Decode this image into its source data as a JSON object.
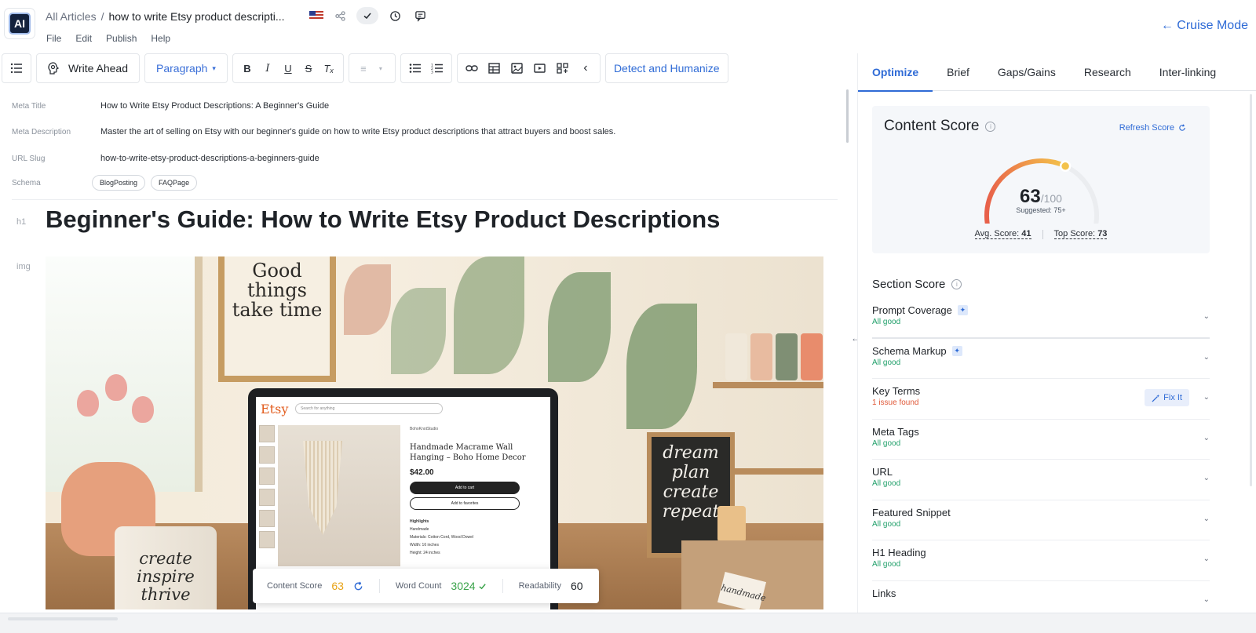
{
  "header": {
    "breadcrumb_root": "All Articles",
    "breadcrumb_sep": "/",
    "article_title": "how to write Etsy product descripti...",
    "logo_text": "AI",
    "menu": [
      "File",
      "Edit",
      "Publish",
      "Help"
    ],
    "cruise_mode": "← Cruise Mode"
  },
  "toolbar": {
    "write_ahead": "Write Ahead",
    "paragraph": "Paragraph",
    "detect_humanize": "Detect and Humanize"
  },
  "meta": {
    "title_label": "Meta Title",
    "title_value": "How to Write Etsy Product Descriptions: A Beginner's Guide",
    "desc_label": "Meta Description",
    "desc_value": "Master the art of selling on Etsy with our beginner's guide on how to write Etsy product descriptions that attract buyers and boost sales.",
    "slug_label": "URL Slug",
    "slug_value": "how-to-write-etsy-product-descriptions-a-beginners-guide",
    "schema_label": "Schema",
    "schema_chips": [
      "BlogPosting",
      "FAQPage"
    ]
  },
  "content": {
    "h1_tag": "h1",
    "h1_text": "Beginner's Guide: How to Write Etsy Product Descriptions",
    "img_tag": "img"
  },
  "hero_image": {
    "frame_text": "Good things take time",
    "etsy_logo": "Etsy",
    "search_placeholder": "Search for anything",
    "shop_name": "BohoKnotStudio",
    "product_title": "Handmade Macrame Wall Hanging – Boho Home Decor",
    "price": "$42.00",
    "add_to_cart": "Add to cart",
    "add_to_favorites": "Add to favorites",
    "highlights_title": "Highlights",
    "highlights": [
      "Handmade",
      "Materials: Cotton Cord, Wood Dowel",
      "Width: 16 inches",
      "Height: 24 inches"
    ],
    "chalkboard_text": "dream plan create repeat",
    "mug_text": "create inspire thrive",
    "box_tag": "handmade"
  },
  "stats": {
    "content_score_label": "Content Score",
    "content_score_value": "63",
    "word_count_label": "Word Count",
    "word_count_value": "3024",
    "readability_label": "Readability",
    "readability_value": "60"
  },
  "panel": {
    "tabs": [
      "Optimize",
      "Brief",
      "Gaps/Gains",
      "Research",
      "Inter-linking"
    ],
    "content_score_title": "Content Score",
    "refresh_score": "Refresh Score",
    "score": 63,
    "score_text": "63",
    "score_max": "/100",
    "suggested": "Suggested: 75+",
    "avg_label": "Avg. Score:",
    "avg_value": "41",
    "top_label": "Top Score:",
    "top_value": "73",
    "section_score_title": "Section Score",
    "fix_it": "Fix It",
    "sections": [
      {
        "name": "Prompt Coverage",
        "status": "All good",
        "sparkle": true
      },
      {
        "name": "Schema Markup",
        "status": "All good",
        "sparkle": true
      },
      {
        "name": "Key Terms",
        "status": "1 issue found",
        "issue": true
      },
      {
        "name": "Meta Tags",
        "status": "All good"
      },
      {
        "name": "URL",
        "status": "All good"
      },
      {
        "name": "Featured Snippet",
        "status": "All good"
      },
      {
        "name": "H1 Heading",
        "status": "All good"
      },
      {
        "name": "Links",
        "status": ""
      }
    ]
  },
  "colors": {
    "accent": "#2f6bd6",
    "good": "#22a06b",
    "issue": "#e05a3a",
    "score_orange": "#e8a317",
    "word_green": "#3aa34a"
  },
  "icons": {
    "outline": "list-icon",
    "write_ahead": "brain-icon",
    "share": "share-icon",
    "check": "check-icon",
    "history": "history-icon",
    "comment": "comment-icon"
  }
}
